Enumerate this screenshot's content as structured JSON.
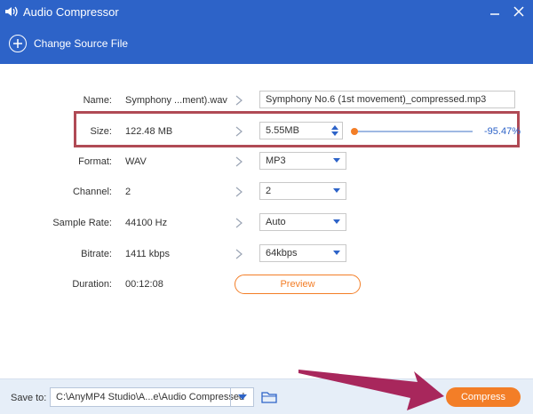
{
  "window": {
    "title": "Audio Compressor"
  },
  "toolbar": {
    "change_source_label": "Change Source File"
  },
  "rows": {
    "name": {
      "label": "Name:",
      "value": "Symphony ...ment).wav",
      "output": "Symphony No.6 (1st movement)_compressed.mp3"
    },
    "size": {
      "label": "Size:",
      "value": "122.48 MB",
      "output": "5.55MB",
      "percent": "-95.47%",
      "slider_fraction": 0.0
    },
    "format": {
      "label": "Format:",
      "value": "WAV",
      "output": "MP3"
    },
    "channel": {
      "label": "Channel:",
      "value": "2",
      "output": "2"
    },
    "sample_rate": {
      "label": "Sample Rate:",
      "value": "44100 Hz",
      "output": "Auto"
    },
    "bitrate": {
      "label": "Bitrate:",
      "value": "1411 kbps",
      "output": "64kbps"
    },
    "duration": {
      "label": "Duration:",
      "value": "00:12:08"
    }
  },
  "preview_label": "Preview",
  "bottom": {
    "save_to_label": "Save to:",
    "path": "C:\\AnyMP4 Studio\\A...e\\Audio Compressed",
    "compress_label": "Compress"
  },
  "colors": {
    "accent": "#2d63c8",
    "orange": "#f37e27",
    "highlight": "#b04a55"
  }
}
